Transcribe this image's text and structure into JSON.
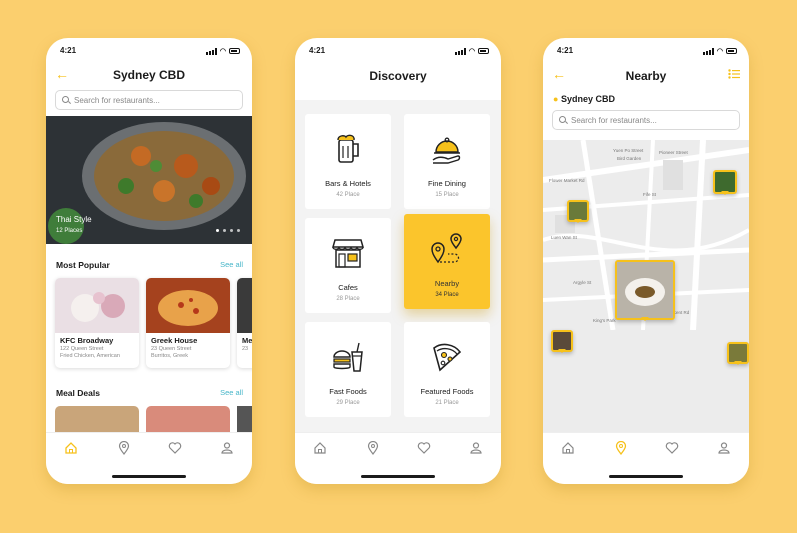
{
  "status_time": "4:21",
  "phone1": {
    "title": "Sydney CBD",
    "search_placeholder": "Search for restaurants...",
    "hero": {
      "title": "Thai Style",
      "subtitle": "12 Places"
    },
    "most_popular": {
      "label": "Most Popular",
      "see_all": "See all",
      "cards": [
        {
          "name": "KFC Broadway",
          "address": "122 Queen Street",
          "cuisine": "Fried Chicken, American"
        },
        {
          "name": "Greek House",
          "address": "23 Queen Street",
          "cuisine": "Burritos, Greek"
        },
        {
          "name": "Me",
          "address": "23",
          "cuisine": ""
        }
      ]
    },
    "meal_deals": {
      "label": "Meal Deals",
      "see_all": "See all"
    }
  },
  "phone2": {
    "title": "Discovery",
    "tiles": [
      {
        "label": "Bars  & Hotels",
        "count": "42 Place",
        "icon": "beer-mug-icon"
      },
      {
        "label": "Fine Dining",
        "count": "15 Place",
        "icon": "cloche-icon"
      },
      {
        "label": "Cafes",
        "count": "28 Place",
        "icon": "cafe-storefront-icon"
      },
      {
        "label": "Nearby",
        "count": "34 Place",
        "icon": "map-pin-route-icon"
      },
      {
        "label": "Fast Foods",
        "count": "29 Place",
        "icon": "fast-food-icon"
      },
      {
        "label": "Featured Foods",
        "count": "21 Place",
        "icon": "pizza-slice-icon"
      }
    ]
  },
  "phone3": {
    "title": "Nearby",
    "location": "Sydney CBD",
    "search_placeholder": "Search for restaurants...",
    "streets": [
      "Yuen Po Street",
      "Bird Garden",
      "Pioneer Street",
      "Flower Market Rd",
      "Fife St",
      "Luen Wan St",
      "Argyle St",
      "Kent Rd",
      "King's Park"
    ]
  },
  "colors": {
    "accent": "#F6C11B",
    "tile_active": "#FBC52C",
    "link": "#47B6C9",
    "background": "#FBCF6E"
  }
}
